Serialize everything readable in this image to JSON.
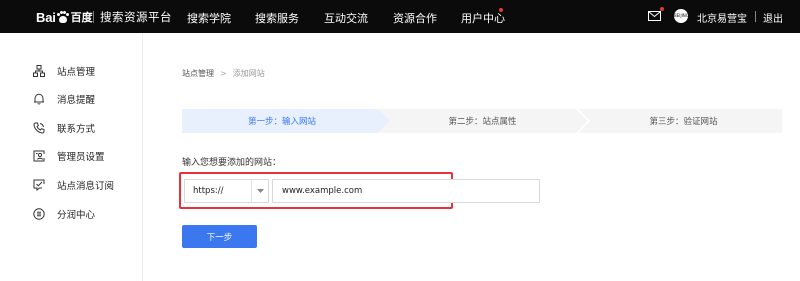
{
  "header": {
    "logo_prefix": "Bai",
    "logo_suffix": "百度",
    "platform_title": "搜索资源平台",
    "nav": [
      {
        "label": "搜索学院"
      },
      {
        "label": "搜索服务"
      },
      {
        "label": "互动交流"
      },
      {
        "label": "资源合作"
      },
      {
        "label": "用户中心"
      }
    ],
    "avatar_text": "BEIJING",
    "user_name": "北京易营宝",
    "logout_label": "退出"
  },
  "sidebar": {
    "items": [
      {
        "label": "站点管理",
        "icon": "sitemap-icon"
      },
      {
        "label": "消息提醒",
        "icon": "bell-icon"
      },
      {
        "label": "联系方式",
        "icon": "phone-icon"
      },
      {
        "label": "管理员设置",
        "icon": "admin-id-icon"
      },
      {
        "label": "站点消息订阅",
        "icon": "subscribe-icon"
      },
      {
        "label": "分润中心",
        "icon": "revenue-icon"
      }
    ]
  },
  "breadcrumb": {
    "root": "站点管理",
    "separator": ">",
    "current": "添加网站"
  },
  "steps": [
    {
      "label": "第一步：输入网站",
      "active": true
    },
    {
      "label": "第二步：站点属性",
      "active": false
    },
    {
      "label": "第三步：验证网站",
      "active": false
    }
  ],
  "form": {
    "field_label": "输入您想要添加的网站：",
    "protocol_value": "https://",
    "url_value": "www.example.com",
    "next_label": "下一步"
  },
  "colors": {
    "topbar": "#0b0b0b",
    "primary": "#3b78f0",
    "active_step_bg": "#e8f0fd",
    "active_step_text": "#3b78f0",
    "step_bg": "#f5f5f5",
    "highlight": "#e6333a",
    "notification_dot": "#e53935"
  }
}
